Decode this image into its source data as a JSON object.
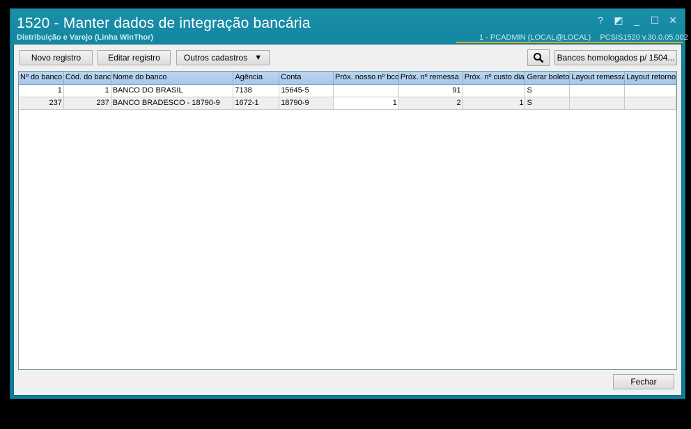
{
  "window": {
    "title": "1520 - Manter dados de integração bancária",
    "subtitle": "Distribuição e Varejo (Linha WinThor)",
    "user": "1 - PCADMIN (LOCAL@LOCAL)",
    "version": "PCSIS1520  v.30.0.05.002",
    "controls": [
      "?",
      "◩",
      "_",
      "☐",
      "✕"
    ]
  },
  "toolbar": {
    "novo": "Novo registro",
    "editar": "Editar registro",
    "outros": "Outros cadastros",
    "bancos": "Bancos homologados p/ 1504..."
  },
  "table": {
    "columns": [
      "Nº do banco",
      "Cód. do banco",
      "Nome do banco",
      "Agência",
      "Conta",
      "Próx. nosso nº bco",
      "Próx. nº remessa",
      "Próx. nº custo dia",
      "Gerar boleto",
      "Layout remessa",
      "Layout retorno"
    ],
    "rows": [
      [
        "1",
        "1",
        "BANCO DO BRASIL",
        "7138",
        "15645-5",
        "",
        "91",
        "",
        "S",
        "",
        ""
      ],
      [
        "237",
        "237",
        "BANCO BRADESCO - 18790-9",
        "1672-1",
        "18790-9",
        "1",
        "2",
        "1",
        "S",
        "",
        ""
      ]
    ]
  },
  "footer": {
    "fechar": "Fechar"
  }
}
